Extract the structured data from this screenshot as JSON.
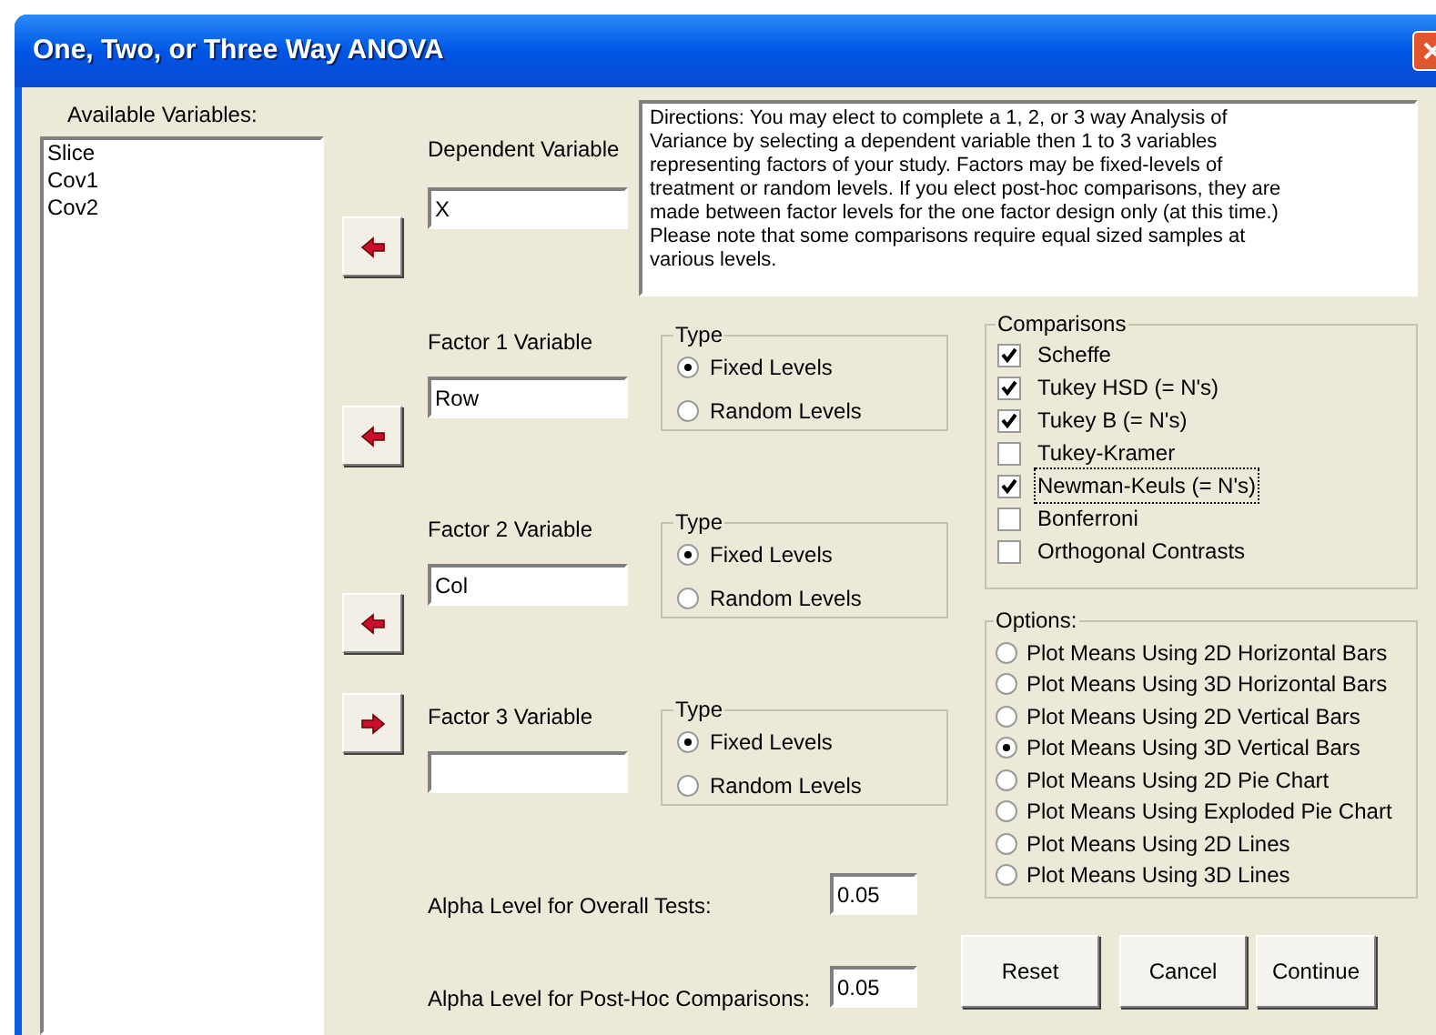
{
  "window": {
    "title": "One, Two, or Three Way ANOVA"
  },
  "available_variables": {
    "label": "Available Variables:",
    "items": [
      "Slice",
      "Cov1",
      "Cov2"
    ]
  },
  "dependent": {
    "label": "Dependent Variable",
    "value": "X",
    "kind": "left"
  },
  "directions": "Directions:  You may elect to complete a 1, 2, or 3 way Analysis of Variance by selecting a dependent variable then 1 to 3 variables representing factors of your study.  Factors may be fixed-levels of treatment or random levels.  If you elect post-hoc comparisons, they are made between factor levels for the one factor design only (at this time.)  Please note that some comparisons require equal sized samples at various levels.",
  "factors": [
    {
      "label": "Factor 1 Variable",
      "value": "Row",
      "kind": "left",
      "type_label": "Type",
      "types": [
        {
          "label": "Fixed Levels",
          "selected": true
        },
        {
          "label": "Random Levels",
          "selected": false
        }
      ]
    },
    {
      "label": "Factor 2 Variable",
      "value": "Col",
      "kind": "left",
      "type_label": "Type",
      "types": [
        {
          "label": "Fixed Levels",
          "selected": true
        },
        {
          "label": "Random Levels",
          "selected": false
        }
      ]
    },
    {
      "label": "Factor 3 Variable",
      "kind": "right",
      "type_label": "Type",
      "types": [
        {
          "label": "Fixed Levels",
          "selected": true
        },
        {
          "label": "Random Levels",
          "selected": false
        }
      ]
    }
  ],
  "comparisons": {
    "label": "Comparisons",
    "items": [
      {
        "label": "Scheffe",
        "checked": true,
        "focused": false
      },
      {
        "label": "Tukey HSD (= N's)",
        "checked": true,
        "focused": false
      },
      {
        "label": "Tukey B (= N's)",
        "checked": true,
        "focused": false
      },
      {
        "label": "Tukey-Kramer",
        "checked": false,
        "focused": false
      },
      {
        "label": "Newman-Keuls (= N's)",
        "checked": true,
        "focused": true
      },
      {
        "label": "Bonferroni",
        "checked": false,
        "focused": false
      },
      {
        "label": "Orthogonal Contrasts",
        "checked": false,
        "focused": false
      }
    ]
  },
  "options": {
    "label": "Options:",
    "items": [
      {
        "label": "Plot Means Using 2D Horizontal Bars",
        "selected": false
      },
      {
        "label": "Plot Means Using 3D Horizontal Bars",
        "selected": false
      },
      {
        "label": "Plot Means Using 2D Vertical Bars",
        "selected": false
      },
      {
        "label": "Plot Means Using 3D Vertical Bars",
        "selected": true
      },
      {
        "label": "Plot Means Using 2D Pie Chart",
        "selected": false
      },
      {
        "label": "Plot Means Using Exploded Pie Chart",
        "selected": false
      },
      {
        "label": "Plot Means Using 2D Lines",
        "selected": false
      },
      {
        "label": "Plot Means Using 3D Lines",
        "selected": false
      }
    ]
  },
  "alpha": [
    {
      "label": "Alpha Level for Overall Tests:",
      "value": "0.05"
    },
    {
      "label": "Alpha Level for Post-Hoc Comparisons:",
      "value": "0.05"
    }
  ],
  "buttons": [
    "Reset",
    "Cancel",
    "Continue"
  ]
}
